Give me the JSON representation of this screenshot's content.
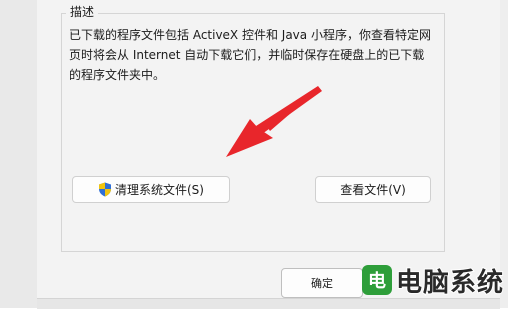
{
  "groupbox": {
    "title": "描述"
  },
  "description": {
    "lines": [
      "已下载的程序文件包括 ActiveX 控件和 Java 小程序，你查看特定网",
      "页时将会从 Internet 自动下载它们，并临时保存在硬盘上的已下载",
      "的程序文件夹中。"
    ]
  },
  "buttons": {
    "cleanup_label": "清理系统文件(S)",
    "view_files_label": "查看文件(V)",
    "ok_label": "确定"
  },
  "watermark": {
    "icon_letter": "电",
    "text": "电脑系统"
  },
  "icons": {
    "cleanup_button_icon": "uac-shield-icon",
    "annotation": "red-arrow"
  },
  "colors": {
    "dialog_background": "#f3f3f3",
    "annotation_arrow": "#e8262b",
    "watermark_green": "#2e9e3a"
  }
}
